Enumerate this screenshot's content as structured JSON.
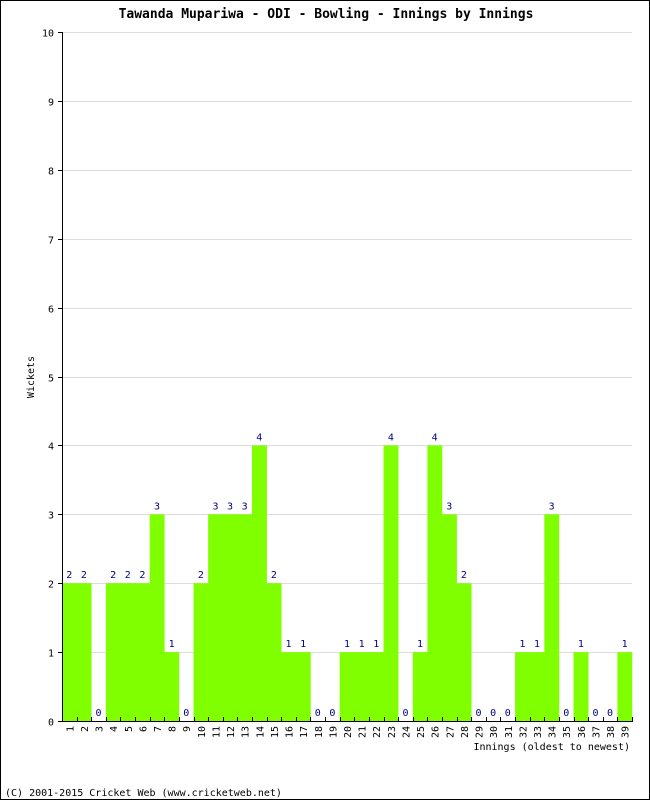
{
  "chart_data": {
    "type": "bar",
    "title": "Tawanda Mupariwa - ODI - Bowling - Innings by Innings",
    "xlabel": "Innings (oldest to newest)",
    "ylabel": "Wickets",
    "ylim": [
      0,
      10
    ],
    "yticks": [
      "0",
      "1",
      "2",
      "3",
      "4",
      "5",
      "6",
      "7",
      "8",
      "9",
      "10"
    ],
    "grid": true,
    "categories": [
      "1",
      "2",
      "3",
      "4",
      "5",
      "6",
      "7",
      "8",
      "9",
      "10",
      "11",
      "12",
      "13",
      "14",
      "15",
      "16",
      "17",
      "18",
      "19",
      "20",
      "21",
      "22",
      "23",
      "24",
      "25",
      "26",
      "27",
      "28",
      "29",
      "30",
      "31",
      "32",
      "33",
      "34",
      "35",
      "36",
      "37",
      "38",
      "39"
    ],
    "values": [
      2,
      2,
      0,
      2,
      2,
      2,
      3,
      1,
      0,
      2,
      3,
      3,
      3,
      4,
      2,
      1,
      1,
      0,
      0,
      1,
      1,
      1,
      4,
      0,
      1,
      4,
      3,
      2,
      0,
      0,
      0,
      1,
      1,
      3,
      0,
      1,
      0,
      0,
      1
    ],
    "bar_color": "#80ff00",
    "label_color": "#000080",
    "grid_color": "#dddddd"
  },
  "footer": "(C) 2001-2015 Cricket Web (www.cricketweb.net)"
}
